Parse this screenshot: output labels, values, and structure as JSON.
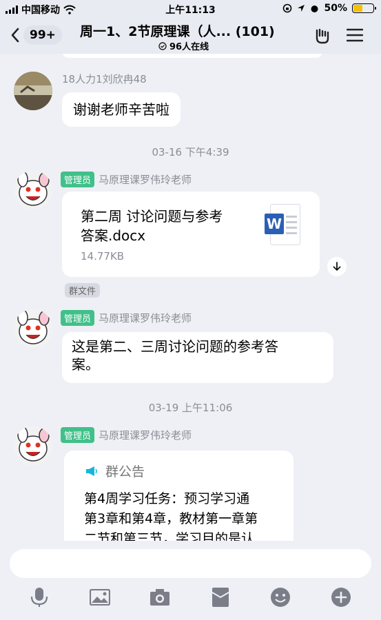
{
  "status_bar": {
    "carrier": "中国移动",
    "time": "上午11:13",
    "battery": "50%",
    "battery_level": 0.5
  },
  "nav": {
    "unread_badge": "99+",
    "title": "周一1、2节原理课（人... (101)",
    "online_count": "96人在线"
  },
  "messages": {
    "m1": {
      "sender": "18人力1刘欣冉48",
      "text": "谢谢老师辛苦啦"
    },
    "ts1": "03-16 下午4:39",
    "m2": {
      "role": "管理员",
      "sender": "马原理课罗伟玲老师",
      "file_name_line1": "第二周 讨论问题与参考",
      "file_name_line2": "答案.docx",
      "file_size": "14.77KB",
      "file_type_letter": "W",
      "file_tag": "群文件"
    },
    "m3": {
      "role": "管理员",
      "sender": "马原理课罗伟玲老师",
      "text_line1": "这是第二、三周讨论问题的参考答",
      "text_line2": "案。"
    },
    "ts2": "03-19 上午11:06",
    "m4": {
      "role": "管理员",
      "sender": "马原理课罗伟玲老师",
      "notice_title": "群公告",
      "notice_line1": "第4周学习任务：预习学习通",
      "notice_line2": "第3章和第4章，教材第一章第",
      "notice_line3": "二节和第三节，学习目的是认"
    }
  },
  "input": {
    "placeholder": ""
  },
  "icons": [
    "back-icon",
    "clock-icon",
    "hand-icon",
    "menu-icon",
    "download-icon",
    "megaphone-icon",
    "mic-icon",
    "image-icon",
    "camera-icon",
    "redpacket-icon",
    "emoji-icon",
    "plus-icon"
  ],
  "colors": {
    "admin_tag": "#41c08a",
    "word_blue": "#2b5fb4",
    "battery_fill": "#f2c200",
    "notice_icon": "#17b6d9"
  }
}
